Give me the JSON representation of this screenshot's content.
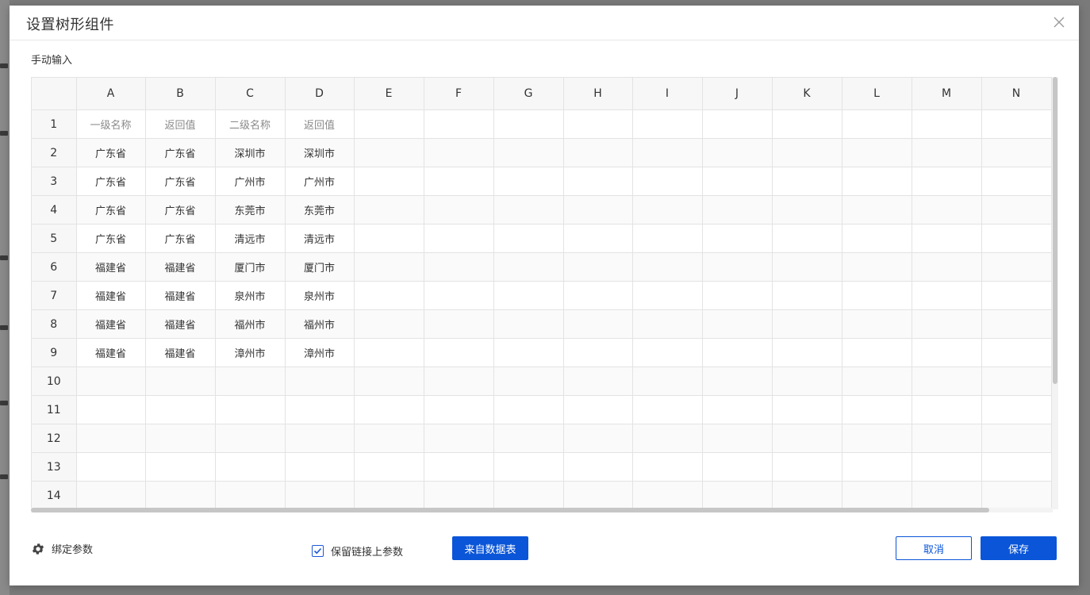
{
  "dialog": {
    "title": "设置树形组件",
    "section_label": "手动输入"
  },
  "sheet": {
    "columns": [
      "A",
      "B",
      "C",
      "D",
      "E",
      "F",
      "G",
      "H",
      "I",
      "J",
      "K",
      "L",
      "M",
      "N"
    ],
    "rows": [
      {
        "num": "1",
        "cells": [
          "一级名称",
          "返回值",
          "二级名称",
          "返回值"
        ]
      },
      {
        "num": "2",
        "cells": [
          "广东省",
          "广东省",
          "深圳市",
          "深圳市"
        ]
      },
      {
        "num": "3",
        "cells": [
          "广东省",
          "广东省",
          "广州市",
          "广州市"
        ]
      },
      {
        "num": "4",
        "cells": [
          "广东省",
          "广东省",
          "东莞市",
          "东莞市"
        ]
      },
      {
        "num": "5",
        "cells": [
          "广东省",
          "广东省",
          "清远市",
          "清远市"
        ]
      },
      {
        "num": "6",
        "cells": [
          "福建省",
          "福建省",
          "厦门市",
          "厦门市"
        ]
      },
      {
        "num": "7",
        "cells": [
          "福建省",
          "福建省",
          "泉州市",
          "泉州市"
        ]
      },
      {
        "num": "8",
        "cells": [
          "福建省",
          "福建省",
          "福州市",
          "福州市"
        ]
      },
      {
        "num": "9",
        "cells": [
          "福建省",
          "福建省",
          "漳州市",
          "漳州市"
        ]
      },
      {
        "num": "10",
        "cells": []
      },
      {
        "num": "11",
        "cells": []
      },
      {
        "num": "12",
        "cells": []
      },
      {
        "num": "13",
        "cells": []
      },
      {
        "num": "14",
        "cells": []
      }
    ]
  },
  "footer": {
    "bind_params_label": "绑定参数",
    "bind_params_icon": "gear-icon",
    "keep_params_label": "保留链接上参数",
    "keep_params_checked": true,
    "from_table_label": "来自数据表",
    "cancel_label": "取消",
    "save_label": "保存"
  },
  "colors": {
    "primary": "#0a55d8",
    "overlay": "#808080"
  }
}
